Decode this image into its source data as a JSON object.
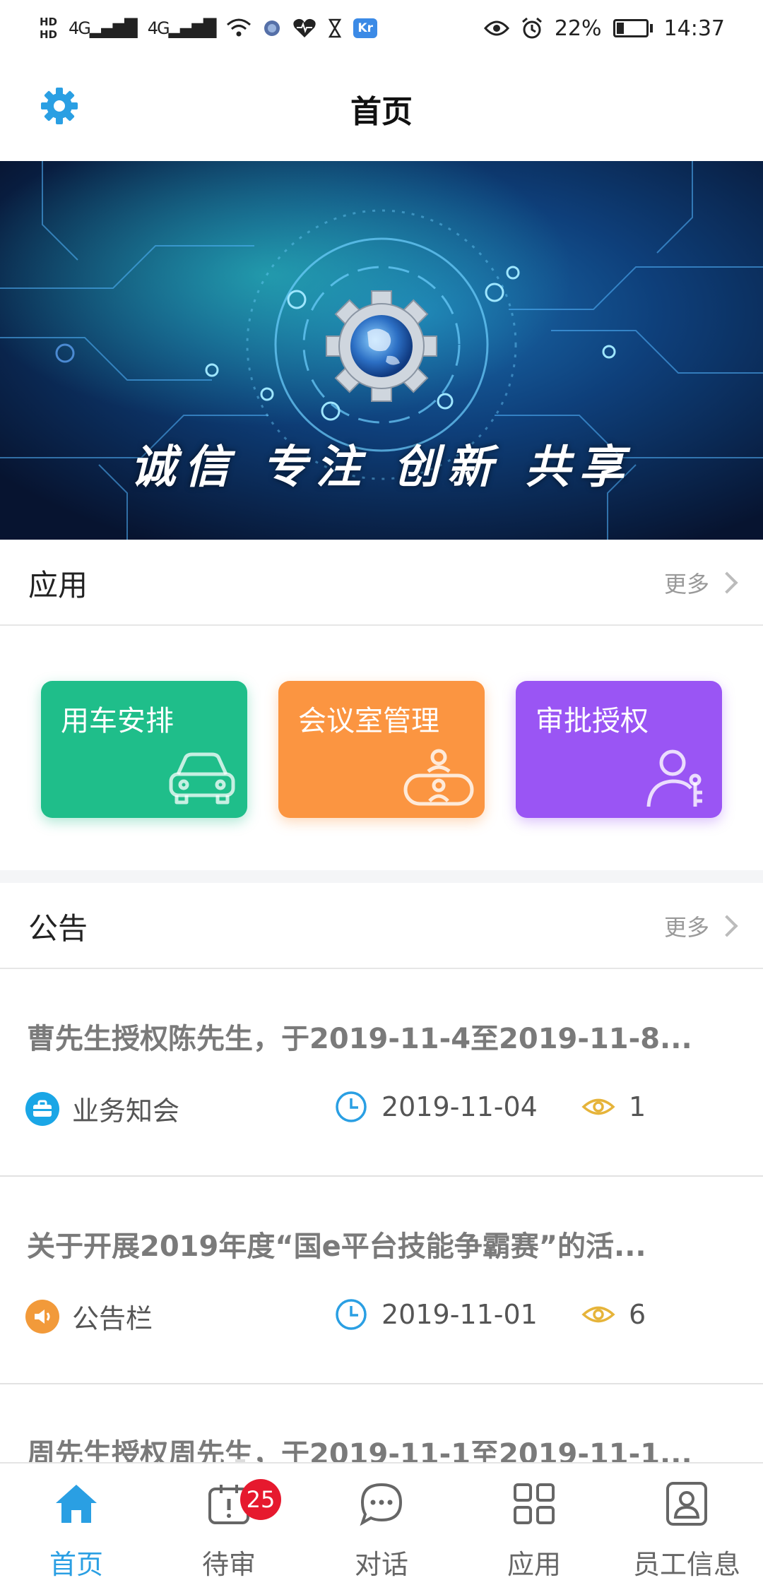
{
  "status_bar": {
    "network_1": "HD",
    "network_2": "HD",
    "signal_1": "4G",
    "signal_2": "4G",
    "app_badge": "Kr",
    "battery": "22%",
    "time": "14:37"
  },
  "header": {
    "title": "首页"
  },
  "banner": {
    "slogan": "诚信 专注 创新 共享"
  },
  "apps_section": {
    "title": "应用",
    "more": "更多",
    "cards": [
      {
        "label": "用车安排",
        "icon": "car-icon",
        "color": "#1fbe8a"
      },
      {
        "label": "会议室管理",
        "icon": "meeting-room-icon",
        "color": "#fb9541"
      },
      {
        "label": "审批授权",
        "icon": "user-key-icon",
        "color": "#9a55f4"
      }
    ]
  },
  "notices_section": {
    "title": "公告",
    "more": "更多",
    "items": [
      {
        "title": "曹先生授权陈先生，于2019-11-4至2019-11-8...",
        "category": "业务知会",
        "category_icon": "briefcase-icon",
        "category_color": "#1aa6e6",
        "date": "2019-11-04",
        "views": "1"
      },
      {
        "title": "关于开展2019年度“国e平台技能争霸赛”的活...",
        "category": "公告栏",
        "category_icon": "speaker-icon",
        "category_color": "#f29a3a",
        "date": "2019-11-01",
        "views": "6"
      },
      {
        "title": "周先生授权周先生，于2019-11-1至2019-11-1...",
        "category": "",
        "date": "",
        "views": ""
      }
    ]
  },
  "tabbar": {
    "tabs": [
      {
        "label": "首页",
        "icon": "home-icon",
        "active": true
      },
      {
        "label": "待审",
        "icon": "pending-review-icon",
        "badge": "25"
      },
      {
        "label": "对话",
        "icon": "chat-icon"
      },
      {
        "label": "应用",
        "icon": "apps-grid-icon"
      },
      {
        "label": "员工信息",
        "icon": "employee-card-icon"
      }
    ]
  },
  "colors": {
    "accent": "#2a9fe3",
    "badge": "#e6192e",
    "date_icon": "#2a9fe3",
    "views_icon": "#e6b43a"
  }
}
